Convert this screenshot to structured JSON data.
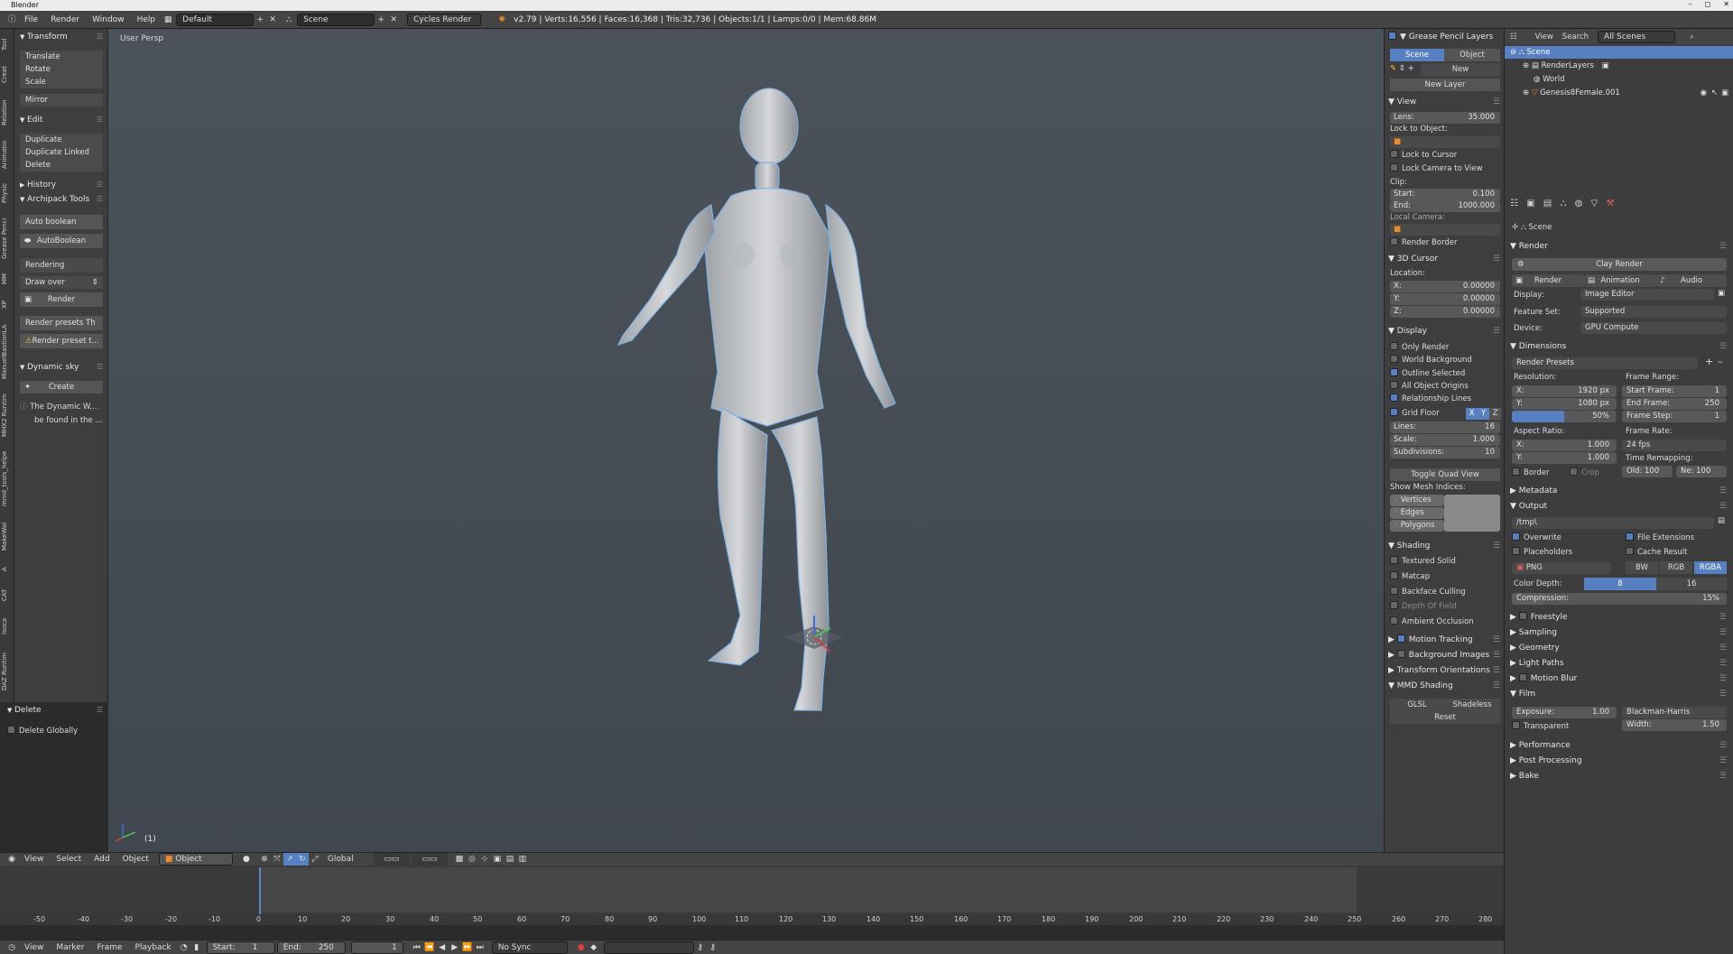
{
  "titlebar": {
    "title": "Blender",
    "minimize": "–",
    "maximize": "◻",
    "close": "✕"
  },
  "menubar": {
    "menus": [
      "File",
      "Render",
      "Window",
      "Help"
    ],
    "layout": "Default",
    "scene": "Scene",
    "engine": "Cycles Render",
    "stats": "v2.79 | Verts:16,556 | Faces:16,368 | Tris:32,736 | Objects:1/1 | Lamps:0/0 | Mem:68.86M"
  },
  "vtabs": [
    "Tool",
    "Creat",
    "Relation",
    "Animatio",
    "Physic",
    "Grease Penci",
    "MM",
    "XP",
    "ManuelBastionLA",
    "MHX2 Runtim",
    "mmd_tools_helpe",
    "MakeWal",
    "A",
    "CAT",
    "Isoca",
    "DAZ Runtim"
  ],
  "shelf": {
    "transform": {
      "title": "Transform",
      "items": [
        "Translate",
        "Rotate",
        "Scale",
        "Mirror"
      ]
    },
    "edit": {
      "title": "Edit",
      "items": [
        "Duplicate",
        "Duplicate Linked",
        "Delete"
      ]
    },
    "history": {
      "title": "History"
    },
    "archipack": {
      "title": "Archipack Tools",
      "auto_boolean": "Auto boolean",
      "autoboolean_btn": "AutoBoolean",
      "rendering": "Rendering",
      "draw_over": "Draw over",
      "render": "Render",
      "render_presets": "Render presets Th",
      "render_preset_t": "Render preset t..."
    },
    "dynamic_sky": {
      "title": "Dynamic sky",
      "create": "Create",
      "info1": "The Dynamic W...",
      "info2": "be found in the ..."
    },
    "delete": {
      "title": "Delete",
      "delete_globally": "Delete Globally"
    }
  },
  "viewport": {
    "label": "User Persp",
    "frame_label": "(1)"
  },
  "v3d_header": {
    "menus": [
      "View",
      "Select",
      "Add",
      "Object"
    ],
    "mode": "Object Mode",
    "orientation": "Global"
  },
  "timeline": {
    "ticks": [
      "-50",
      "-40",
      "-30",
      "-20",
      "-10",
      "0",
      "10",
      "20",
      "30",
      "40",
      "50",
      "60",
      "70",
      "80",
      "90",
      "100",
      "110",
      "120",
      "130",
      "140",
      "150",
      "160",
      "170",
      "180",
      "190",
      "200",
      "210",
      "220",
      "230",
      "240",
      "250",
      "260",
      "270",
      "280"
    ],
    "menus": [
      "View",
      "Marker",
      "Frame",
      "Playback"
    ],
    "start_label": "Start:",
    "start": "1",
    "end_label": "End:",
    "end": "250",
    "current": "1",
    "sync": "No Sync"
  },
  "npanel": {
    "grease_pencil": {
      "title": "Grease Pencil Layers",
      "tab_scene": "Scene",
      "tab_object": "Object",
      "new": "New",
      "new_layer": "New Layer"
    },
    "view": {
      "title": "View",
      "lens_label": "Lens:",
      "lens": "35.000",
      "lock_to_object": "Lock to Object:",
      "lock_to_cursor": "Lock to Cursor",
      "lock_camera": "Lock Camera to View",
      "clip": "Clip:",
      "start_label": "Start:",
      "start": "0.100",
      "end_label": "End:",
      "end": "1000.000",
      "local_camera": "Local Camera:",
      "render_border": "Render Border"
    },
    "cursor": {
      "title": "3D Cursor",
      "location": "Location:",
      "x_label": "X:",
      "x": "0.00000",
      "y_label": "Y:",
      "y": "0.00000",
      "z_label": "Z:",
      "z": "0.00000"
    },
    "display": {
      "title": "Display",
      "only_render": "Only Render",
      "world_background": "World Background",
      "outline_selected": "Outline Selected",
      "all_object_origins": "All Object Origins",
      "relationship_lines": "Relationship Lines",
      "grid_floor": "Grid Floor",
      "axis_x": "X",
      "axis_y": "Y",
      "axis_z": "Z",
      "lines_label": "Lines:",
      "lines": "16",
      "scale_label": "Scale:",
      "scale": "1.000",
      "subdivisions_label": "Subdivisions:",
      "subdivisions": "10",
      "toggle_quad": "Toggle Quad View",
      "mesh_indices": "Show Mesh Indices:",
      "vertices": "Vertices",
      "edges": "Edges",
      "polygons": "Polygons"
    },
    "shading": {
      "title": "Shading",
      "textured_solid": "Textured Solid",
      "matcap": "Matcap",
      "backface_culling": "Backface Culling",
      "depth_of_field": "Depth Of Field",
      "ambient_occlusion": "Ambient Occlusion"
    },
    "motion_tracking": "Motion Tracking",
    "background_images": "Background Images",
    "transform_orientations": "Transform Orientations",
    "mmd_shading": {
      "title": "MMD Shading",
      "glsl": "GLSL",
      "shadeless": "Shadeless",
      "reset": "Reset"
    }
  },
  "outliner": {
    "view": "View",
    "search": "Search",
    "filter": "All Scenes",
    "rows": [
      "Scene",
      "RenderLayers",
      "World",
      "Genesis8Female.001"
    ]
  },
  "properties": {
    "context": "Scene",
    "render": {
      "title": "Render",
      "clay_render": "Clay Render",
      "render_btn": "Render",
      "animation_btn": "Animation",
      "audio_btn": "Audio",
      "display_label": "Display:",
      "display": "Image Editor",
      "feature_label": "Feature Set:",
      "feature": "Supported",
      "device_label": "Device:",
      "device": "GPU Compute"
    },
    "dimensions": {
      "title": "Dimensions",
      "render_presets": "Render Presets",
      "resolution": "Resolution:",
      "res_x_label": "X:",
      "res_x": "1920 px",
      "res_y_label": "Y:",
      "res_y": "1080 px",
      "res_pct": "50%",
      "frame_range": "Frame Range:",
      "start_frame_label": "Start Frame:",
      "start_frame": "1",
      "end_frame_label": "End Frame:",
      "end_frame": "250",
      "frame_step_label": "Frame Step:",
      "frame_step": "1",
      "aspect": "Aspect Ratio:",
      "asp_x_label": "X:",
      "asp_x": "1.000",
      "asp_y_label": "Y:",
      "asp_y": "1.000",
      "frame_rate": "Frame Rate:",
      "fps": "24 fps",
      "time_remap": "Time Remapping:",
      "border": "Border",
      "crop": "Crop",
      "old": "Old: 100",
      "new": "Ne: 100"
    },
    "metadata": {
      "title": "Metadata"
    },
    "output": {
      "title": "Output",
      "path": "/tmp\\",
      "overwrite": "Overwrite",
      "file_ext": "File Extensions",
      "placeholders": "Placeholders",
      "cache_result": "Cache Result",
      "format": "PNG",
      "bw": "BW",
      "rgb": "RGB",
      "rgba": "RGBA",
      "color_depth": "Color Depth:",
      "depth8": "8",
      "depth16": "16",
      "compression_label": "Compression:",
      "compression": "15%"
    },
    "collapsed": [
      "Freestyle",
      "Sampling",
      "Geometry",
      "Light Paths",
      "Motion Blur"
    ],
    "film": {
      "title": "Film",
      "exposure_label": "Exposure:",
      "exposure": "1.00",
      "filter": "Blackman-Harris",
      "transparent": "Transparent",
      "width_label": "Width:",
      "width": "1.50"
    },
    "tail": [
      "Performance",
      "Post Processing",
      "Bake"
    ]
  }
}
